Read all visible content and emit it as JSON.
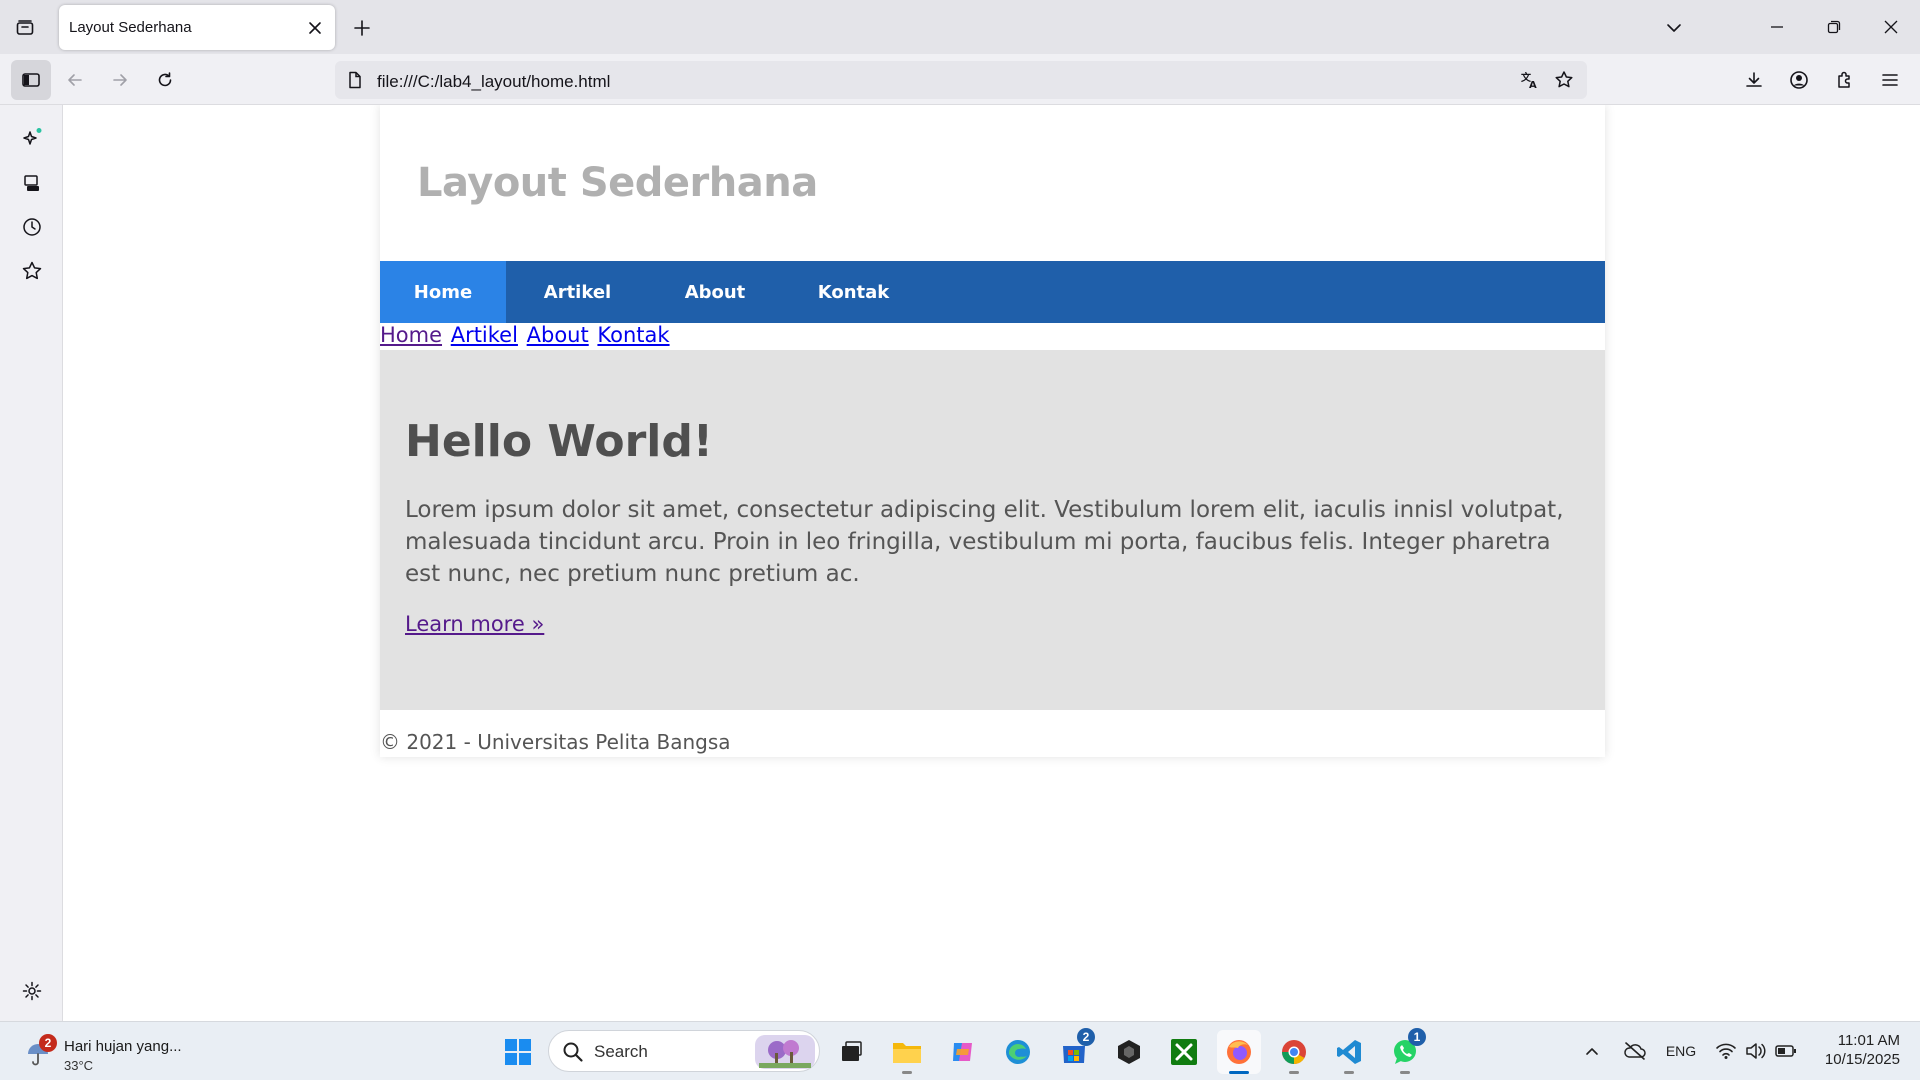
{
  "browser": {
    "tab_title": "Layout Sederhana",
    "url": "file:///C:/lab4_layout/home.html"
  },
  "page": {
    "site_title": "Layout Sederhana",
    "nav": [
      {
        "label": "Home"
      },
      {
        "label": "Artikel"
      },
      {
        "label": "About"
      },
      {
        "label": "Kontak"
      }
    ],
    "plain_links": [
      "Home",
      "Artikel",
      "About",
      "Kontak"
    ],
    "hero_title": "Hello World!",
    "hero_text": "Lorem ipsum dolor sit amet, consectetur adipiscing elit. Vestibulum lorem elit, iaculis innisl volutpat, malesuada tincidunt arcu. Proin in leo fringilla, vestibulum mi porta, faucibus felis. Integer pharetra est nunc, nec pretium nunc pretium ac.",
    "hero_link": "Learn more »",
    "footer": "© 2021 - Universitas Pelita Bangsa"
  },
  "taskbar": {
    "weather_title": "Hari hujan yang...",
    "weather_temp": "33°C",
    "weather_badge": "2",
    "search_label": "Search",
    "store_badge": "2",
    "whatsapp_badge": "1",
    "lang": "ENG",
    "time": "11:01 AM",
    "date": "10/15/2025"
  },
  "colors": {
    "nav_bg": "#1f5faa",
    "nav_active": "#2b83e6",
    "hero_bg": "#e2e2e2",
    "title_gray": "#b0b0b0"
  }
}
